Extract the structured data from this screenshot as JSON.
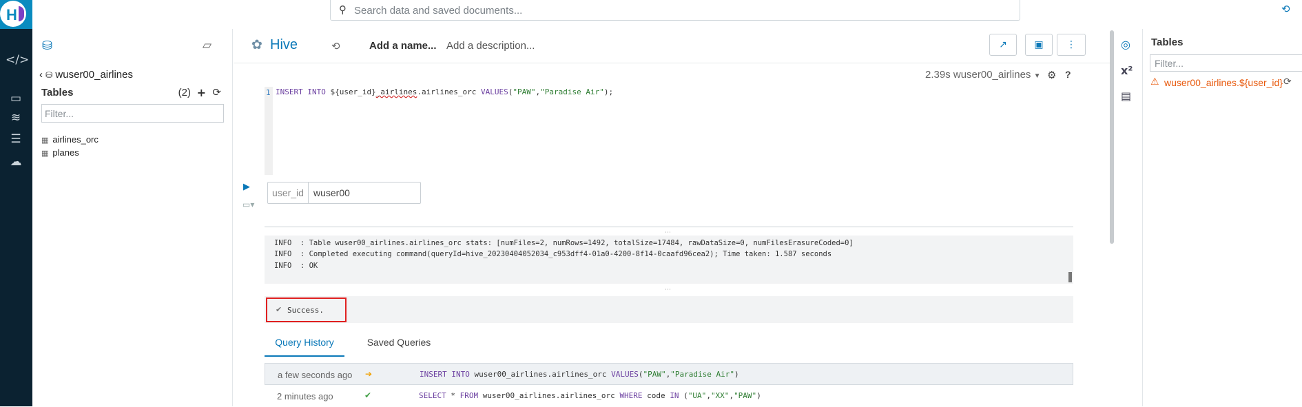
{
  "search": {
    "placeholder": "Search data and saved documents..."
  },
  "assist": {
    "database": "wuser00_airlines",
    "tables_label": "Tables",
    "table_count": "(2)",
    "filter_placeholder": "Filter...",
    "tables": [
      "airlines_orc",
      "planes"
    ]
  },
  "editor": {
    "engine": "Hive",
    "name_placeholder": "Add a name...",
    "description_placeholder": "Add a description...",
    "exec_info": "2.39s wuser00_airlines",
    "line_number": "1",
    "variable": {
      "name": "user_id",
      "value": "wuser00"
    },
    "log": [
      "INFO  : Table wuser00_airlines.airlines_orc stats: [numFiles=2, numRows=1492, totalSize=17484, rawDataSize=0, numFilesErasureCoded=0]",
      "INFO  : Completed executing command(queryId=hive_20230404052034_c953dff4-01a0-4200-8f14-0caafd96cea2); Time taken: 1.587 seconds",
      "INFO  : OK"
    ],
    "status": "Success."
  },
  "tabs": [
    "Query History",
    "Saved Queries"
  ],
  "history": [
    {
      "when": "a few seconds ago",
      "status": "running",
      "status_color": "#f0a30a"
    },
    {
      "when": "2 minutes ago",
      "status": "success",
      "status_color": "#43a047"
    }
  ],
  "right_panel": {
    "title": "Tables",
    "filter_placeholder": "Filter...",
    "warning_table": "wuser00_airlines.${user_id}"
  }
}
